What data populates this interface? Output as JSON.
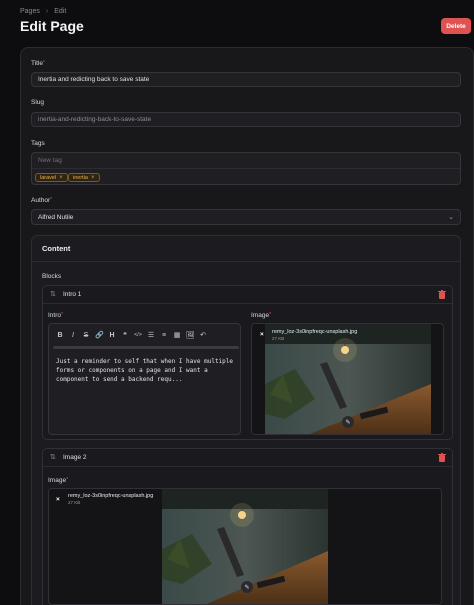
{
  "breadcrumb": {
    "items": [
      "Pages",
      "Edit"
    ],
    "separator": "›"
  },
  "page": {
    "title": "Edit Page",
    "delete_label": "Delete"
  },
  "form": {
    "title_label": "Title",
    "title_value": "Inertia and redicting back to save state",
    "slug_label": "Slug",
    "slug_value": "inertia-and-redicting-back-to-save-state",
    "tags_label": "Tags",
    "tags_placeholder": "New tag",
    "tags": [
      {
        "label": "laravel",
        "remove": "×"
      },
      {
        "label": "inertia",
        "remove": "×"
      }
    ],
    "author_label": "Author",
    "author_value": "Alfred Nutile"
  },
  "content": {
    "heading": "Content",
    "blocks_label": "Blocks",
    "blocks": [
      {
        "name": "Intro 1",
        "intro_label": "Intro",
        "image_label": "Image",
        "toolbar": [
          "B",
          "I",
          "S",
          "🔗",
          "H",
          "❝",
          "</>",
          "☰",
          "≡",
          "▦",
          "🖼",
          "↶"
        ],
        "text": "Just a reminder to self that when I have multiple forms or components on a page and I want a component to send a backend requ...",
        "file_name": "remy_loz-3s0inpfreqc-unsplash.jpg",
        "file_size": "27 KB"
      },
      {
        "name": "Image 2",
        "image_label": "Image",
        "file_name": "remy_loz-3s0inpfreqc-unsplash.jpg",
        "file_size": "27 KB"
      }
    ]
  },
  "icons": {
    "drag": "drag-handle-icon",
    "trash": "trash-icon",
    "close": "close-icon",
    "edit": "pencil-icon",
    "chevron": "chevron-down-icon"
  },
  "colors": {
    "accent_delete": "#e05252",
    "tag_text": "#e8b24a"
  }
}
